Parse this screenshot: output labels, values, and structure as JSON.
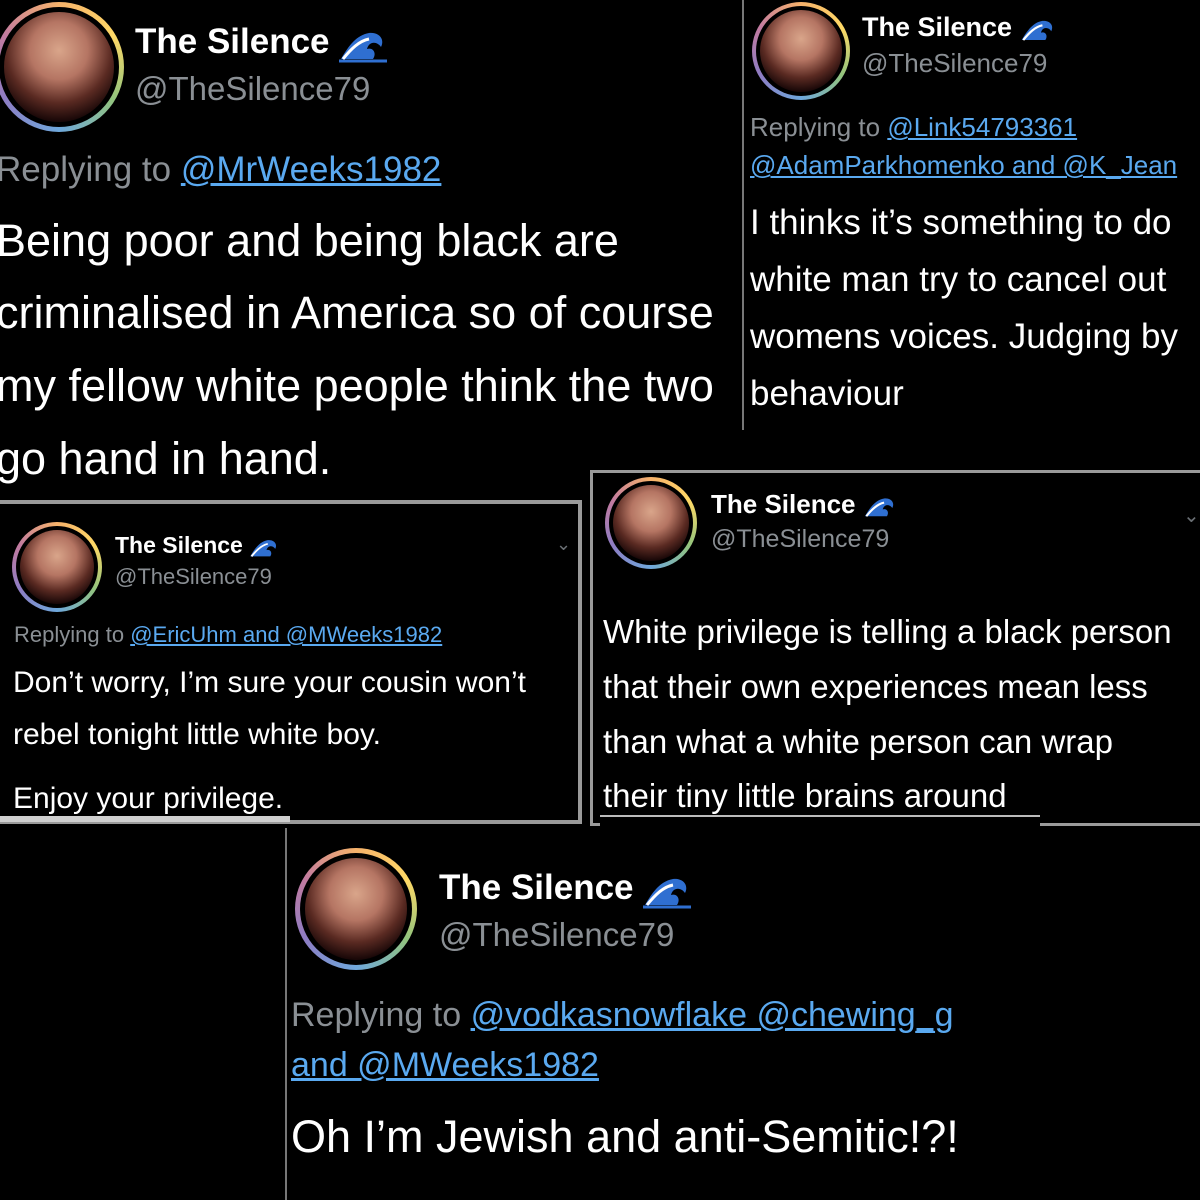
{
  "tweets": [
    {
      "name": "The Silence",
      "handle": "@TheSilence79",
      "replying_prefix": "Replying to",
      "replying_to": [
        "@MrWeeks1982"
      ],
      "body_lines": [
        "Being poor and being black are",
        "criminalised in America so of course",
        "my fellow white people think the two",
        "go hand in hand."
      ]
    },
    {
      "name": "The Silence",
      "handle": "@TheSilence79",
      "replying_prefix": "Replying to",
      "replying_to": [
        "@Link54793361",
        "@AdamParkhomenko and @K_Jean"
      ],
      "body_lines": [
        "I thinks it’s something to do",
        "white man try to cancel out",
        "womens voices. Judging by",
        "behaviour"
      ]
    },
    {
      "name": "The Silence",
      "handle": "@TheSilence79",
      "replying_prefix": "Replying to",
      "replying_to": [
        "@EricUhm and @MWeeks1982"
      ],
      "body_lines": [
        "Don’t worry, I’m sure your cousin won’t",
        "rebel tonight little white boy.",
        "Enjoy your privilege."
      ]
    },
    {
      "name": "The Silence",
      "handle": "@TheSilence79",
      "replying_prefix": "",
      "replying_to": [],
      "body_lines": [
        "White privilege is telling a black person",
        "that their own experiences mean less",
        "than what a white person can wrap",
        "their tiny little brains around"
      ]
    },
    {
      "name": "The Silence",
      "handle": "@TheSilence79",
      "replying_prefix": "Replying to",
      "replying_to": [
        "@vodkasnowflake @chewing_g",
        "and @MWeeks1982"
      ],
      "body_lines": [
        "Oh I’m Jewish and anti-Semitic!?!"
      ]
    }
  ],
  "icons": {
    "name_badge": "wave-icon",
    "menu": "chevron-down-icon"
  },
  "colors": {
    "background": "#000000",
    "mention": "#5aa9f0",
    "secondary_text": "#8a8f94"
  }
}
